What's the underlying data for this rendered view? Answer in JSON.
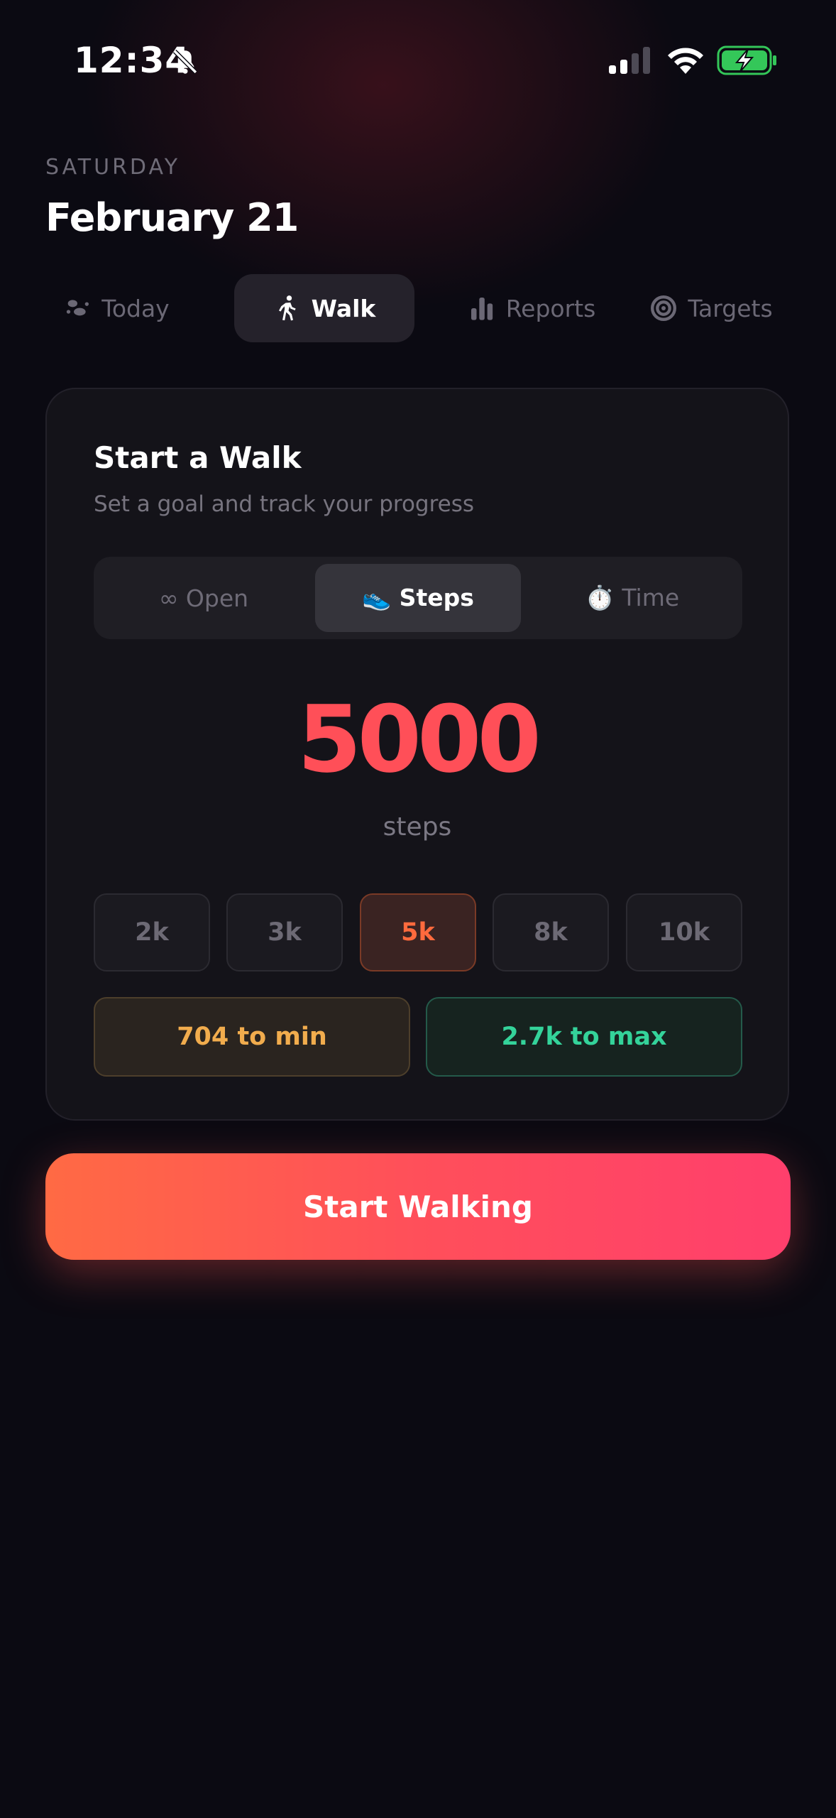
{
  "status_bar": {
    "time": "12:34"
  },
  "header": {
    "weekday": "SATURDAY",
    "date": "February 21"
  },
  "nav_tabs": [
    {
      "label": "Today",
      "icon": "footprints-icon",
      "active": false
    },
    {
      "label": "Walk",
      "icon": "walking-person-icon",
      "active": true
    },
    {
      "label": "Reports",
      "icon": "bar-chart-icon",
      "active": false
    },
    {
      "label": "Targets",
      "icon": "target-icon",
      "active": false
    }
  ],
  "card": {
    "title": "Start a Walk",
    "subtitle": "Set a goal and track your progress",
    "modes": [
      {
        "label": "∞ Open",
        "active": false
      },
      {
        "label": "👟 Steps",
        "active": true
      },
      {
        "label": "⏱️ Time",
        "active": false
      }
    ],
    "goal_value": "5000",
    "goal_unit": "steps",
    "presets": [
      {
        "label": "2k",
        "active": false
      },
      {
        "label": "3k",
        "active": false
      },
      {
        "label": "5k",
        "active": true
      },
      {
        "label": "8k",
        "active": false
      },
      {
        "label": "10k",
        "active": false
      }
    ],
    "to_min": "704 to min",
    "to_max": "2.7k to max"
  },
  "start_button": {
    "label": "Start Walking"
  },
  "colors": {
    "background": "#0b0a12",
    "accent_red": "#ff4f58",
    "accent_orange": "#ff6a3d",
    "min_color": "#f1ac4d",
    "max_color": "#34d39a",
    "battery_green": "#34c759"
  }
}
